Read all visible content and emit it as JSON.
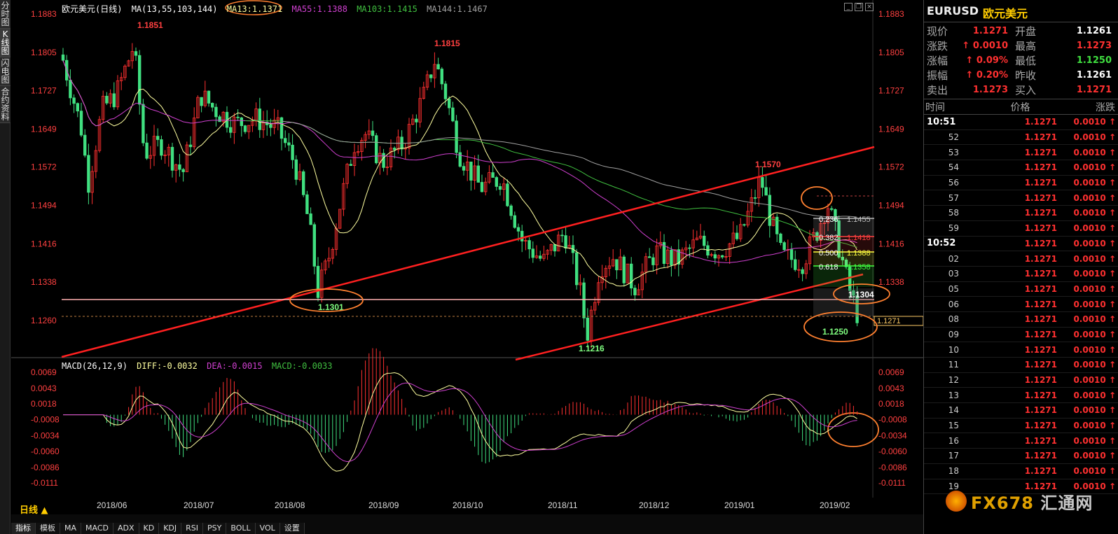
{
  "side_tabs": [
    "分时图",
    "K线图",
    "闪电图",
    "合约资料"
  ],
  "legend": {
    "name": "欧元美元(日线)",
    "ma_spec": "MA(13,55,103,144)",
    "ma13": "MA13:1.1371",
    "ma55": "MA55:1.1388",
    "ma103": "MA103:1.1415",
    "ma144": "MA144:1.1467"
  },
  "macd_legend": {
    "spec": "MACD(26,12,9)",
    "diff": "DIFF:-0.0032",
    "dea": "DEA:-0.0015",
    "macd": "MACD:-0.0033"
  },
  "price_axis": [
    "1.1883",
    "1.1805",
    "1.1727",
    "1.1649",
    "1.1572",
    "1.1494",
    "1.1416",
    "1.1338",
    "1.1260"
  ],
  "macd_axis": [
    "0.0069",
    "0.0043",
    "0.0018",
    "-0.0008",
    "-0.0034",
    "-0.0060",
    "-0.0086",
    "-0.0111"
  ],
  "x_axis": [
    "2018/06",
    "2018/07",
    "2018/08",
    "2018/09",
    "2018/10",
    "2018/11",
    "2018/12",
    "2019/01",
    "2019/02"
  ],
  "annotations": {
    "high1": "1.1851",
    "high2": "1.1815",
    "high3": "1.1570",
    "low1": "1.1301",
    "low2": "1.1216",
    "low3": "1.1250",
    "level_1304": "1.1304",
    "current": "1.1271"
  },
  "fib": [
    {
      "ratio": "0.236",
      "price": "1.1455",
      "color": "#bbbbbb"
    },
    {
      "ratio": "0.382",
      "price": "1.1418",
      "color": "#ff4040"
    },
    {
      "ratio": "0.500",
      "price": "1.1388",
      "color": "#ffff40"
    },
    {
      "ratio": "0.618",
      "price": "1.1358",
      "color": "#40ff40"
    }
  ],
  "bottom_tabs": [
    "指标",
    "模板",
    "MA",
    "MACD",
    "ADX",
    "KD",
    "KDJ",
    "RSI",
    "PSY",
    "BOLL",
    "VOL",
    "设置"
  ],
  "period": "日线 ▲",
  "quote": {
    "symbol": "EURUSD",
    "name": "欧元美元",
    "rows": [
      {
        "l": "现价",
        "v": "1.1271",
        "vc": "#ff3030",
        "l2": "开盘",
        "v2": "1.1261",
        "v2c": "#ffffff"
      },
      {
        "l": "涨跌",
        "v": "↑ 0.0010",
        "vc": "#ff3030",
        "l2": "最高",
        "v2": "1.1273",
        "v2c": "#ff3030"
      },
      {
        "l": "涨幅",
        "v": "↑ 0.09%",
        "vc": "#ff3030",
        "l2": "最低",
        "v2": "1.1250",
        "v2c": "#40e040"
      },
      {
        "l": "振幅",
        "v": "↑ 0.20%",
        "vc": "#ff3030",
        "l2": "昨收",
        "v2": "1.1261",
        "v2c": "#ffffff"
      },
      {
        "l": "卖出",
        "v": "1.1273",
        "vc": "#ff3030",
        "l2": "买入",
        "v2": "1.1271",
        "v2c": "#ff3030"
      }
    ],
    "tick_header": [
      "时间",
      "价格",
      "涨跌"
    ],
    "ticks": [
      {
        "t": "10:51",
        "p": "1.1271",
        "c": "0.0010 ↑"
      },
      {
        "t": "52",
        "p": "1.1271",
        "c": "0.0010 ↑"
      },
      {
        "t": "53",
        "p": "1.1271",
        "c": "0.0010 ↑"
      },
      {
        "t": "54",
        "p": "1.1271",
        "c": "0.0010 ↑"
      },
      {
        "t": "56",
        "p": "1.1271",
        "c": "0.0010 ↑"
      },
      {
        "t": "57",
        "p": "1.1271",
        "c": "0.0010 ↑"
      },
      {
        "t": "58",
        "p": "1.1271",
        "c": "0.0010 ↑"
      },
      {
        "t": "59",
        "p": "1.1271",
        "c": "0.0010 ↑"
      },
      {
        "t": "10:52",
        "p": "1.1271",
        "c": "0.0010 ↑"
      },
      {
        "t": "02",
        "p": "1.1271",
        "c": "0.0010 ↑"
      },
      {
        "t": "03",
        "p": "1.1271",
        "c": "0.0010 ↑"
      },
      {
        "t": "05",
        "p": "1.1271",
        "c": "0.0010 ↑"
      },
      {
        "t": "06",
        "p": "1.1271",
        "c": "0.0010 ↑"
      },
      {
        "t": "08",
        "p": "1.1271",
        "c": "0.0010 ↑"
      },
      {
        "t": "09",
        "p": "1.1271",
        "c": "0.0010 ↑"
      },
      {
        "t": "10",
        "p": "1.1271",
        "c": "0.0010 ↑"
      },
      {
        "t": "11",
        "p": "1.1271",
        "c": "0.0010 ↑"
      },
      {
        "t": "12",
        "p": "1.1271",
        "c": "0.0010 ↑"
      },
      {
        "t": "13",
        "p": "1.1271",
        "c": "0.0010 ↑"
      },
      {
        "t": "14",
        "p": "1.1271",
        "c": "0.0010 ↑"
      },
      {
        "t": "15",
        "p": "1.1271",
        "c": "0.0010 ↑"
      },
      {
        "t": "16",
        "p": "1.1271",
        "c": "0.0010 ↑"
      },
      {
        "t": "17",
        "p": "1.1271",
        "c": "0.0010 ↑"
      },
      {
        "t": "18",
        "p": "1.1271",
        "c": "0.0010 ↑"
      },
      {
        "t": "19",
        "p": "1.1271",
        "c": "0.0010 ↑"
      }
    ]
  },
  "watermark": {
    "brand": "FX678",
    "cn": "汇通网"
  },
  "colors": {
    "up": "#ff3030",
    "down": "#40e080",
    "ma13": "#ffffa0",
    "ma55": "#d040d0",
    "ma103": "#40c040",
    "ma144": "#a0a0a0",
    "trend": "#ff2020",
    "circle": "#ff8030"
  }
}
